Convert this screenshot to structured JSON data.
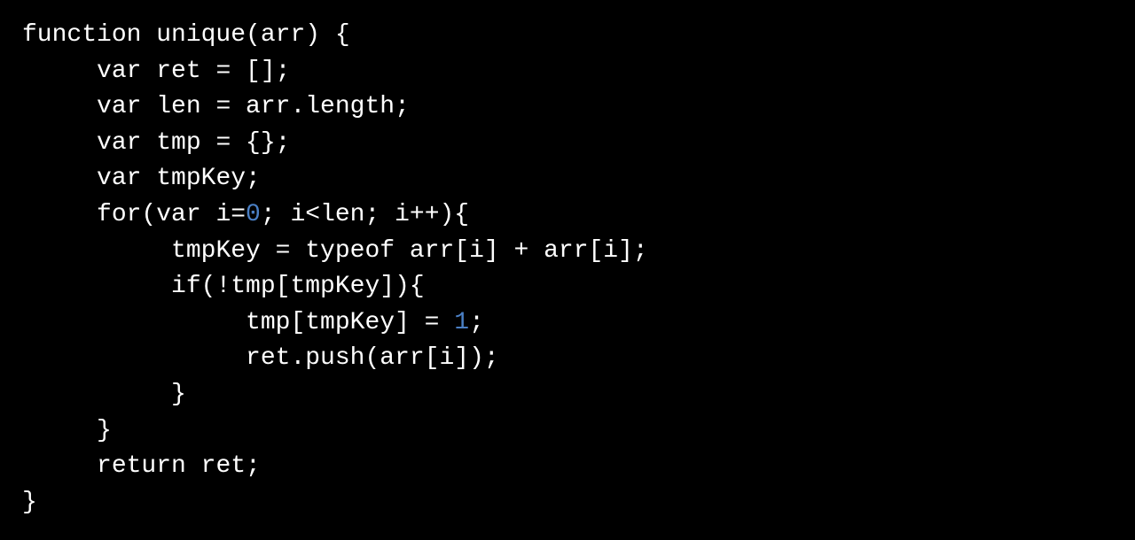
{
  "code": {
    "lines": [
      {
        "indent": 0,
        "segments": [
          {
            "text": "function unique(arr) {",
            "cls": ""
          }
        ]
      },
      {
        "indent": 1,
        "segments": [
          {
            "text": "var ret = [];",
            "cls": ""
          }
        ]
      },
      {
        "indent": 1,
        "segments": [
          {
            "text": "var len = arr.length;",
            "cls": ""
          }
        ]
      },
      {
        "indent": 1,
        "segments": [
          {
            "text": "var tmp = {};",
            "cls": ""
          }
        ]
      },
      {
        "indent": 1,
        "segments": [
          {
            "text": "var tmpKey;",
            "cls": ""
          }
        ]
      },
      {
        "indent": 1,
        "segments": [
          {
            "text": "for(var i=",
            "cls": ""
          },
          {
            "text": "0",
            "cls": "number"
          },
          {
            "text": "; i<len; i++){",
            "cls": ""
          }
        ]
      },
      {
        "indent": 2,
        "segments": [
          {
            "text": "tmpKey = typeof arr[i] + arr[i];",
            "cls": ""
          }
        ]
      },
      {
        "indent": 2,
        "segments": [
          {
            "text": "if(!tmp[tmpKey]){",
            "cls": ""
          }
        ]
      },
      {
        "indent": 3,
        "segments": [
          {
            "text": "tmp[tmpKey] = ",
            "cls": ""
          },
          {
            "text": "1",
            "cls": "number"
          },
          {
            "text": ";",
            "cls": ""
          }
        ]
      },
      {
        "indent": 3,
        "segments": [
          {
            "text": "ret.push(arr[i]);",
            "cls": ""
          }
        ]
      },
      {
        "indent": 2,
        "segments": [
          {
            "text": "}",
            "cls": ""
          }
        ]
      },
      {
        "indent": 1,
        "segments": [
          {
            "text": "}",
            "cls": ""
          }
        ]
      },
      {
        "indent": 1,
        "segments": [
          {
            "text": "return ret;",
            "cls": ""
          }
        ]
      },
      {
        "indent": 0,
        "segments": [
          {
            "text": "}",
            "cls": ""
          }
        ]
      }
    ],
    "indentUnit": "     "
  }
}
